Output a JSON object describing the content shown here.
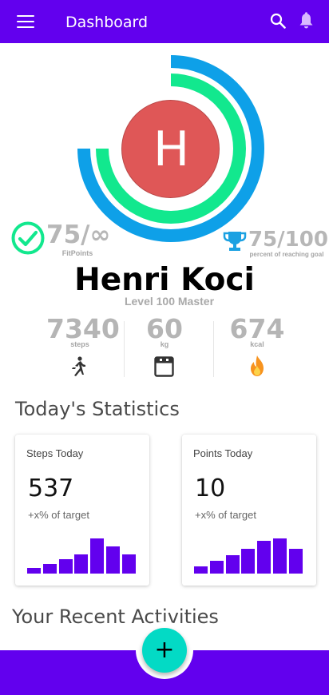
{
  "app_bar": {
    "title": "Dashboard",
    "color": "#6200ee",
    "icons": [
      "menu-icon",
      "search-icon",
      "bell-icon"
    ]
  },
  "profile": {
    "avatar_letter": "H",
    "avatar_color": "#df5757",
    "name": "Henri Koci",
    "level": "Level 100 Master",
    "rings": {
      "outer": {
        "color": "#0ea0e8",
        "progress": 0.75
      },
      "inner": {
        "color": "#12e88e",
        "progress": 0.75
      }
    },
    "fitpoints": {
      "value": "75/∞",
      "label": "FitPoints",
      "icon": "check-circle-icon",
      "color": "#12e88e"
    },
    "goal": {
      "value": "75/100",
      "label": "percent of reaching goal",
      "icon": "trophy-icon",
      "color": "#0ea0e8"
    }
  },
  "stats": [
    {
      "value": "7340",
      "unit": "steps",
      "icon": "running-icon"
    },
    {
      "value": "60",
      "unit": "kg",
      "icon": "scale-icon"
    },
    {
      "value": "674",
      "unit": "kcal",
      "icon": "fire-icon"
    }
  ],
  "todays_statistics": {
    "title": "Today's Statistics",
    "cards": [
      {
        "title": "Steps Today",
        "value": "537",
        "subtitle": "+x% of target",
        "bars": [
          7,
          12,
          18,
          24,
          44,
          34,
          24
        ]
      },
      {
        "title": "Points Today",
        "value": "10",
        "subtitle": "+x% of target",
        "bars": [
          7,
          12,
          18,
          24,
          32,
          34,
          24
        ]
      }
    ],
    "bar_color": "#6200ee"
  },
  "recent_activities": {
    "title": "Your Recent Activities"
  },
  "fab": {
    "label": "+",
    "color": "#03dac5"
  }
}
